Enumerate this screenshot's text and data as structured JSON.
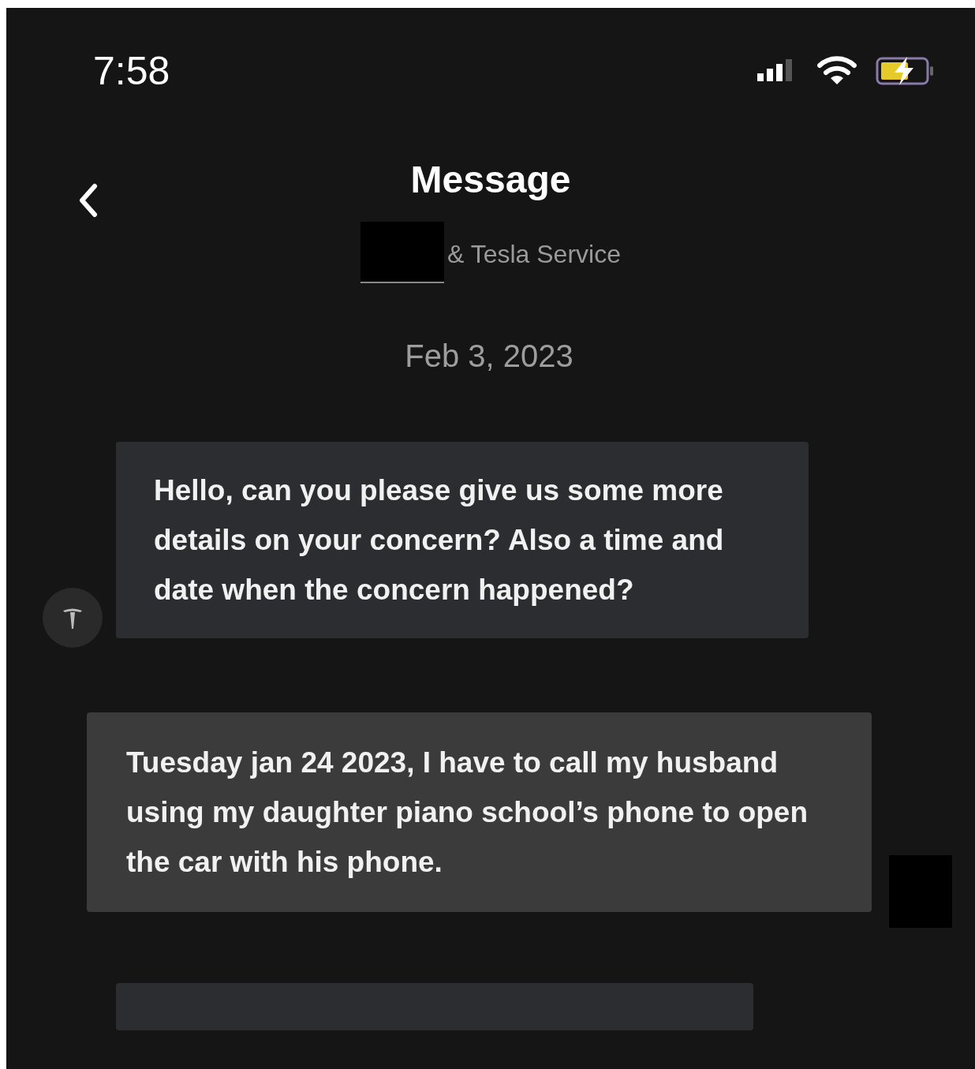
{
  "status_bar": {
    "time": "7:58"
  },
  "header": {
    "title": "Message",
    "subtitle": "& Tesla Service"
  },
  "date": "Feb 3, 2023",
  "messages": [
    {
      "kind": "incoming",
      "text": "Hello, can you please give us some more details on your concern? Also a time and date when the concern happened?"
    },
    {
      "kind": "outgoing",
      "text": "Tuesday jan 24 2023, I have to call my husband using my daughter piano school’s phone to open the car with his phone."
    }
  ]
}
